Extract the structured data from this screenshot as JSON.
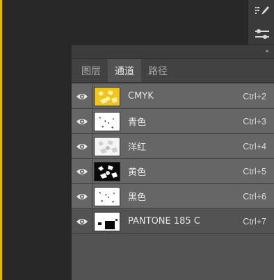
{
  "panel": {
    "collapse_icon": "«",
    "tabs": [
      {
        "label": "图层",
        "active": false
      },
      {
        "label": "通道",
        "active": true
      },
      {
        "label": "路径",
        "active": false
      }
    ],
    "channels": [
      {
        "name": "CMYK",
        "shortcut": "Ctrl+2",
        "visible": true,
        "selected": true
      },
      {
        "name": "青色",
        "shortcut": "Ctrl+3",
        "visible": true,
        "selected": true
      },
      {
        "name": "洋红",
        "shortcut": "Ctrl+4",
        "visible": true,
        "selected": true
      },
      {
        "name": "黄色",
        "shortcut": "Ctrl+5",
        "visible": true,
        "selected": true
      },
      {
        "name": "黑色",
        "shortcut": "Ctrl+6",
        "visible": true,
        "selected": true
      },
      {
        "name": "PANTONE 185 C",
        "shortcut": "Ctrl+7",
        "visible": true,
        "selected": false
      }
    ]
  },
  "colors": {
    "accent_yellow": "#e6b800",
    "selected_row": "#666666",
    "panel_bg": "#535353"
  }
}
